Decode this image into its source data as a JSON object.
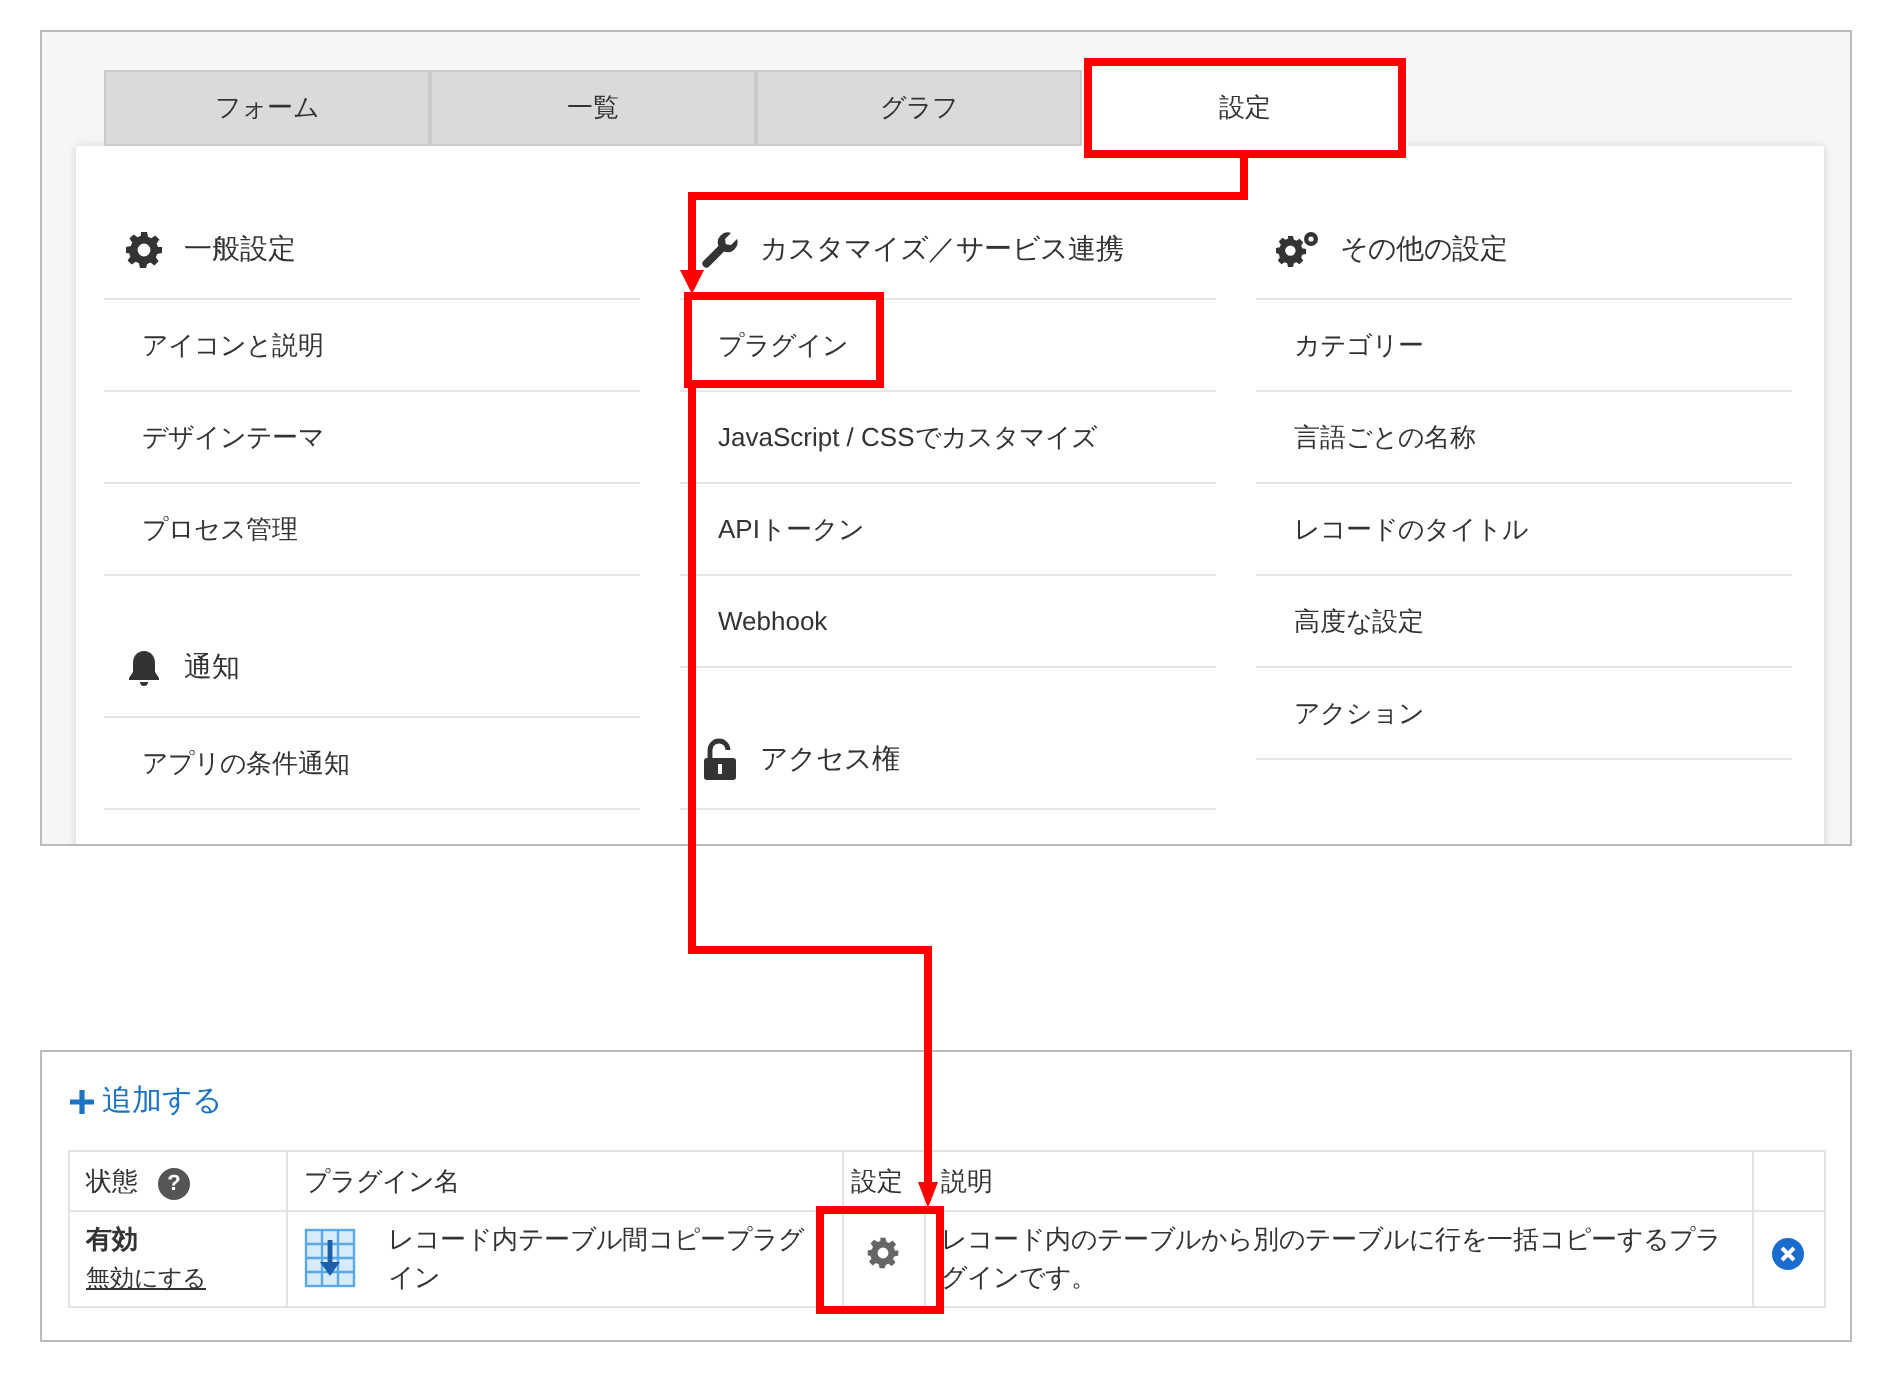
{
  "settings_panel": {
    "tabs": [
      {
        "label": "フォーム",
        "selected": false
      },
      {
        "label": "一覧",
        "selected": false
      },
      {
        "label": "グラフ",
        "selected": false
      },
      {
        "label": "設定",
        "selected": true
      }
    ],
    "columns": [
      {
        "sections": [
          {
            "title": "一般設定",
            "items": [
              "アイコンと説明",
              "デザインテーマ",
              "プロセス管理"
            ]
          },
          {
            "title": "通知",
            "items": [
              "アプリの条件通知"
            ]
          }
        ]
      },
      {
        "sections": [
          {
            "title": "カスタマイズ／サービス連携",
            "items": [
              "プラグイン",
              "JavaScript / CSSでカスタマイズ",
              "APIトークン",
              "Webhook"
            ]
          },
          {
            "title": "アクセス権"
          }
        ]
      },
      {
        "sections": [
          {
            "title": "その他の設定",
            "items": [
              "カテゴリー",
              "言語ごとの名称",
              "レコードのタイトル",
              "高度な設定",
              "アクション"
            ]
          }
        ]
      }
    ]
  },
  "plugins": {
    "add_link": "追加する",
    "columns": [
      {
        "label": "状態",
        "help": "?"
      },
      {
        "label": "プラグイン名"
      },
      {
        "label": "設定"
      },
      {
        "label": "説明"
      }
    ],
    "rows": [
      {
        "status": "有効",
        "toggle_link": "無効にする",
        "name": "レコード内テーブル間コピープラグイン",
        "description": "レコード内のテーブルから別のテーブルに行を一括コピーするプラグインです。"
      }
    ]
  }
}
